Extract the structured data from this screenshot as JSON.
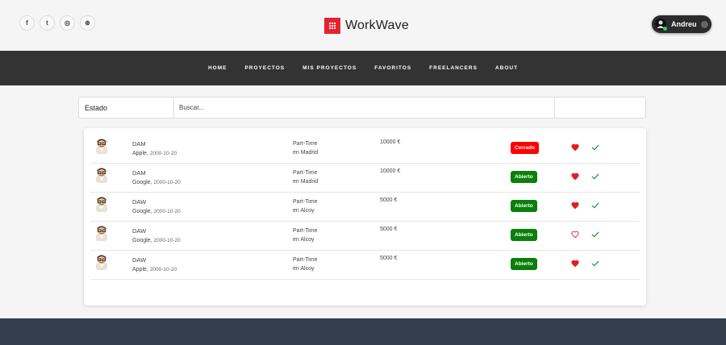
{
  "social": [
    {
      "name": "facebook",
      "glyph": "f"
    },
    {
      "name": "twitter",
      "glyph": "t"
    },
    {
      "name": "instagram",
      "glyph": "◎"
    },
    {
      "name": "dribbble",
      "glyph": "⊛"
    }
  ],
  "brand": {
    "name": "WorkWave",
    "color": "#e3232f"
  },
  "user": {
    "name": "Andreu"
  },
  "nav": [
    "HOME",
    "PROYECTOS",
    "MIS PROYECTOS",
    "FAVORITOS",
    "FREELANCERS",
    "ABOUT"
  ],
  "filter": {
    "estado_label": "Estado",
    "search_placeholder": "Buscar..."
  },
  "colors": {
    "nav_bg": "#333333",
    "closed": "#ff0000",
    "open": "#008000",
    "heart": "#e02020",
    "check": "#2e9e3e",
    "footer": "#343d4b"
  },
  "jobs": [
    {
      "title": "DAM",
      "company": "Apple,",
      "date": "2000-10-20",
      "type": "Part-Time",
      "location": "en Madrid",
      "salary": "10000 €",
      "status": "Cerrado",
      "status_color": "#ff0000",
      "favorite": true
    },
    {
      "title": "DAM",
      "company": "Google,",
      "date": "2000-10-20",
      "type": "Part-Time",
      "location": "en Madrid",
      "salary": "10000 €",
      "status": "Abierto",
      "status_color": "#0a7f0a",
      "favorite": true
    },
    {
      "title": "DAW",
      "company": "Google,",
      "date": "2000-10-20",
      "type": "Part-Time",
      "location": "en Alcoy",
      "salary": "5000 €",
      "status": "Abierto",
      "status_color": "#0a7f0a",
      "favorite": true
    },
    {
      "title": "DAW",
      "company": "Google,",
      "date": "2000-10-20",
      "type": "Part-Time",
      "location": "en Alcoy",
      "salary": "5000 €",
      "status": "Abierto",
      "status_color": "#0a7f0a",
      "favorite": false
    },
    {
      "title": "DAW",
      "company": "Apple,",
      "date": "2000-10-20",
      "type": "Part-Time",
      "location": "en Alcoy",
      "salary": "5000 €",
      "status": "Abierto",
      "status_color": "#0a7f0a",
      "favorite": true
    }
  ]
}
